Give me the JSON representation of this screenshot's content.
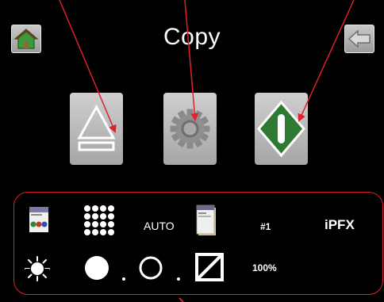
{
  "header": {
    "title": "Copy"
  },
  "buttons": {
    "home": "home-icon",
    "back": "back-arrow-icon",
    "eject": "eject-icon",
    "settings": "gear-icon",
    "start": "start-icon"
  },
  "status": {
    "density_mode": "AUTO",
    "tray": "#1",
    "finisher": "iPFX",
    "zoom": "100%"
  },
  "colors": {
    "background": "#000000",
    "text": "#ffffff",
    "start_green": "#2e7a33",
    "annotation_red": "#e0202a",
    "button_gray": "#b5b5b5"
  }
}
